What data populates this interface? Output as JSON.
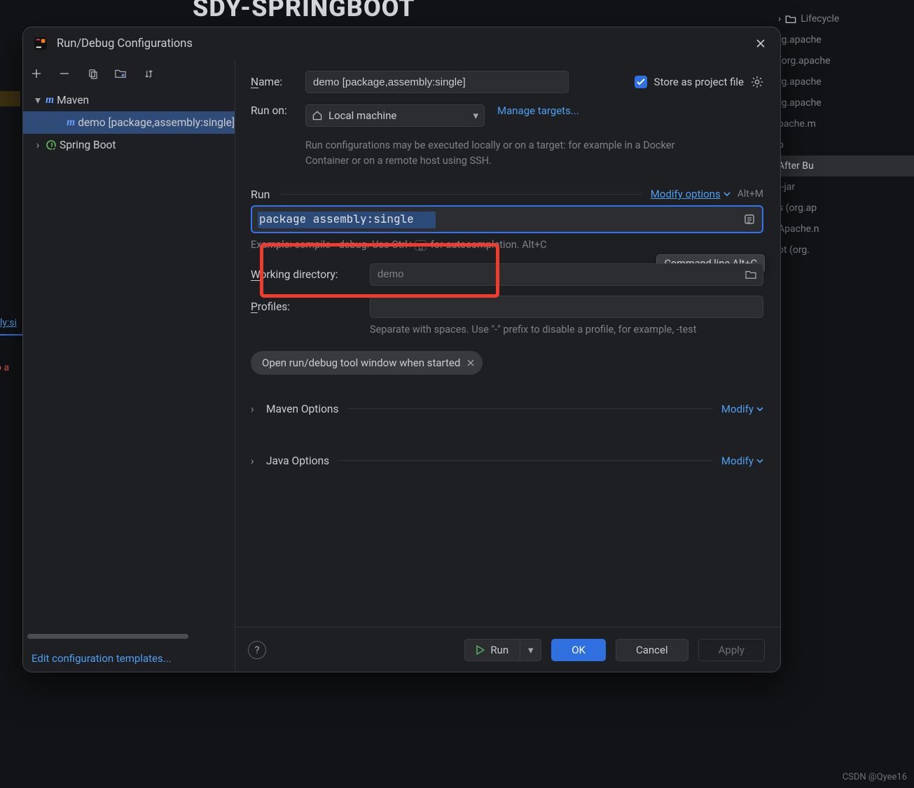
{
  "background": {
    "header_title": "SDY-SPRINGBOOT",
    "right_rows": [
      {
        "label": "Lifecycle",
        "icon": "folder"
      },
      {
        "label": "rg.apache",
        "icon": ""
      },
      {
        "label": "(org.apache",
        "icon": ""
      },
      {
        "label": "rg.apache",
        "icon": ""
      },
      {
        "label": "rg.apache",
        "icon": ""
      },
      {
        "label": "pache.m",
        "icon": ""
      },
      {
        "label": "p",
        "icon": ""
      },
      {
        "label": " After Bu",
        "icon": "",
        "highlight": true
      },
      {
        "label": "t-jar",
        "icon": ""
      },
      {
        "label": "s (org.ap",
        "icon": ""
      },
      {
        "label": "Apache.n",
        "icon": ""
      },
      {
        "label": "ot (org.",
        "icon": ""
      }
    ],
    "lower_left_tab": "ly:si",
    "lower_left_err": "o  a",
    "watermark": "CSDN @Qyee16"
  },
  "dialog": {
    "title": "Run/Debug Configurations",
    "tree": {
      "maven_label": "Maven",
      "demo_label": "demo [package,assembly:single]",
      "springboot_label": "Spring Boot"
    },
    "edit_templates": "Edit configuration templates...",
    "form": {
      "name_label": "Name:",
      "name_value": "demo [package,assembly:single]",
      "store_label": "Store as project file",
      "run_on_label": "Run on:",
      "run_on_value": "Local machine",
      "manage_targets": "Manage targets...",
      "run_on_help": "Run configurations may be executed locally or on a target: for example in a Docker Container or on a remote host using SSH.",
      "run_header": "Run",
      "modify_options": "Modify options",
      "modify_shortcut": "Alt+M",
      "tooltip": "Command line Alt+C",
      "command_line": "package assembly:single",
      "command_hint_pre": "Example: compile --debug. Use Ctrl+",
      "command_hint_post": " for autocompletion. Alt+C",
      "working_dir_label": "Working directory:",
      "working_dir_value": "demo",
      "profiles_label": "Profiles:",
      "profiles_hint": "Separate with spaces. Use \"-\" prefix to disable a profile, for example, -test",
      "chip": "Open run/debug tool window when started",
      "maven_options": "Maven Options",
      "java_options": "Java Options",
      "modify_label": "Modify"
    },
    "footer": {
      "run": "Run",
      "ok": "OK",
      "cancel": "Cancel",
      "apply": "Apply"
    }
  }
}
